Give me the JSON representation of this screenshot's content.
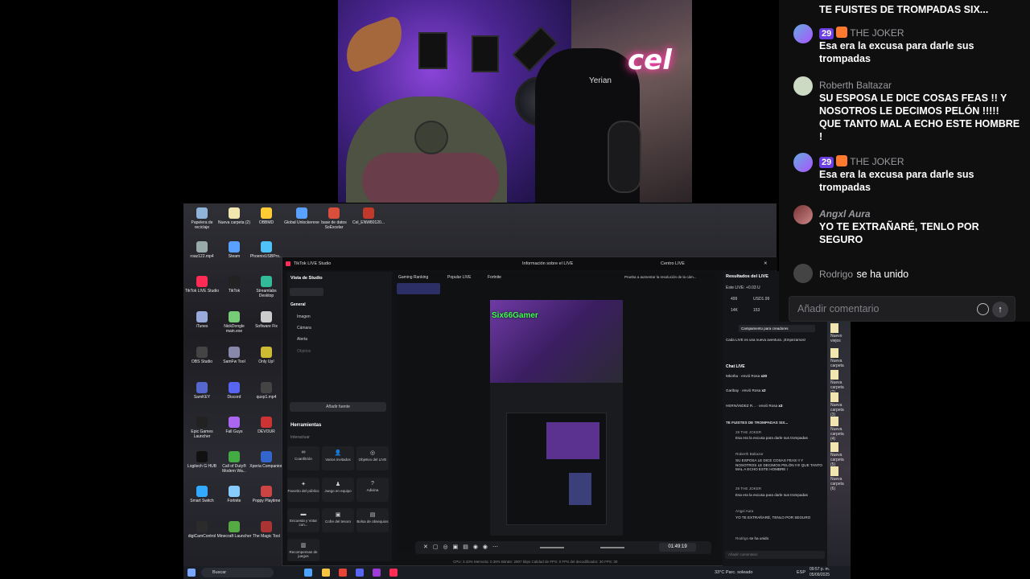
{
  "webcam": {
    "brand_logo": "cel",
    "cap_text": "Yerian"
  },
  "desktop_icons": [
    {
      "label": "Papelera de reciclaje"
    },
    {
      "label": "Nueva carpeta (2)"
    },
    {
      "label": "OBBMD"
    },
    {
      "label": "Global Unlockerexe"
    },
    {
      "label": "base de datos SoExcelar"
    },
    {
      "label": "Cel_ENW80120..."
    },
    {
      "label": "roaz122.mp4"
    },
    {
      "label": "Steam"
    },
    {
      "label": "PhoenixUSBPro..."
    },
    {
      "label": "TikTok LIVE Studio"
    },
    {
      "label": "TikTok"
    },
    {
      "label": "Streamlabs Desktop"
    },
    {
      "label": "iTunes"
    },
    {
      "label": "NickDongle main.exe"
    },
    {
      "label": "Software Fix"
    },
    {
      "label": "OBS Studio"
    },
    {
      "label": "SamFw Tool"
    },
    {
      "label": "Only Up!"
    },
    {
      "label": "SamKEY"
    },
    {
      "label": "Discord"
    },
    {
      "label": "quxp1.mp4"
    },
    {
      "label": "Epic Games Launcher"
    },
    {
      "label": "Fall Guys"
    },
    {
      "label": "DEVOUR"
    },
    {
      "label": "Logitech G HUB"
    },
    {
      "label": "Call of Duty® Modern Wa..."
    },
    {
      "label": "Xperia Companion"
    },
    {
      "label": "Smart Switch"
    },
    {
      "label": "Fortnite"
    },
    {
      "label": "Poppy Playtime"
    },
    {
      "label": "digiCamControl"
    },
    {
      "label": "Minecraft Launcher"
    },
    {
      "label": "The Magic Tool"
    }
  ],
  "right_files": [
    "Nuevo viejos",
    "Nueva carpeta",
    "Nueva carpeta (2)",
    "Nueva carpeta (3)",
    "Nueva carpeta (4)",
    "Nueva carpeta (5)",
    "Nueva carpeta (6)"
  ],
  "tiktok": {
    "window_title": "TikTok LIVE Studio",
    "header_center": "Información sobre el LIVE",
    "center_link": "Centro LIVE",
    "view_label": "Vista de Studio",
    "tabs": [
      "Gaming Ranking",
      "Popular LIVE",
      "Fortnite"
    ],
    "tip": "Prueba a aumentar la resolución de la cám...",
    "sources_header": "General",
    "sources": [
      "Imagen",
      "Cámara",
      "Alerta",
      "Objetos"
    ],
    "add_source": "Añadir fuente",
    "tools_title": "Herramientas",
    "tools_sub": "Interactuar",
    "tools": [
      "Coanfitrión",
      "Varios invitados",
      "Objetivo del LIVE",
      "Favorito del público",
      "Juego en equipo",
      "Adivina",
      "Encuesta y Votar con...",
      "Cofre del tesoro",
      "Bolsa de obsequios",
      "Recompensas de juegos"
    ],
    "preview_name": "Six66Gamer",
    "timer": "01:49:19",
    "status": "CPU: 3.43%   Memoria: 0.38%   Bitrate: 2907 kbps   Calidad de FPS: 0   FPS del decodificador: 30   FPS: 30",
    "results_title": "Resultados del LIVE",
    "live_stat": "Este LIVE: +0.03 U",
    "stats": {
      "likes": "499",
      "usd": "USD1.99",
      "views": "14K",
      "gifts": "153"
    },
    "campaign": "Campamento para creadores",
    "campaign_text": "Cada LIVE es una nueva aventura. ¡Empezamos!",
    "chat_title": "Chat LIVE",
    "gifts": [
      {
        "user": "Mkotha",
        "action": "envió Rosa",
        "count": "x20"
      },
      {
        "user": "Garibay",
        "action": "envió Rosa",
        "count": "x2"
      },
      {
        "user": "HERNÁNDEZ R...",
        "action": "envió Rosa",
        "count": "x3"
      }
    ],
    "mini_chat": [
      {
        "user": "",
        "text": "TE FUISTES DE TROMPADAS SIX..."
      },
      {
        "user": "29 THE JOKER",
        "text": "Esa era la excusa para darle sus trompadas"
      },
      {
        "user": "Roberth Baltazar",
        "text": "SU ESPOSA LE DICE COSAS FEAS !! Y NOSOTROS LE DECIMOS PELÓN !!!!! QUE TANTO MAL A ECHO ESTE HOMBRE !"
      },
      {
        "user": "29 THE JOKER",
        "text": "Esa era la excusa para darle sus trompadas"
      },
      {
        "user": "Angxl Aura",
        "text": "YO TE EXTRAÑARÉ, TENLO POR SEGURO"
      },
      {
        "user": "Rodrigo",
        "text": "se ha unido"
      }
    ],
    "comment_placeholder": "Añadir comentario"
  },
  "taskbar": {
    "search": "Buscar",
    "weather": "33°C  Parc. soleado",
    "lang": "ESP",
    "time": "09:57 p. m.",
    "date": "05/09/2025"
  },
  "chat": {
    "messages": [
      {
        "user": "",
        "text": "TE FUISTES DE TROMPADAS SIX..."
      },
      {
        "user": "THE JOKER",
        "badge": "29",
        "text": "Esa era la excusa para darle sus trompadas"
      },
      {
        "user": "Roberth Baltazar",
        "text": "SU ESPOSA LE DICE COSAS FEAS !! Y NOSOTROS LE DECIMOS PELÓN !!!!! QUE TANTO MAL A ECHO ESTE HOMBRE !"
      },
      {
        "user": "THE JOKER",
        "badge": "29",
        "text": "Esa era la excusa para darle sus trompadas"
      },
      {
        "user": "Angxl  Aura",
        "text": "YO TE EXTRAÑARÉ, TENLO POR SEGURO"
      },
      {
        "user": "Rodrigo",
        "text": "se ha unido"
      }
    ],
    "placeholder": "Añadir comentario",
    "colors": {
      "badge": "#6c3fe0",
      "accent": "#fe2c55"
    }
  }
}
